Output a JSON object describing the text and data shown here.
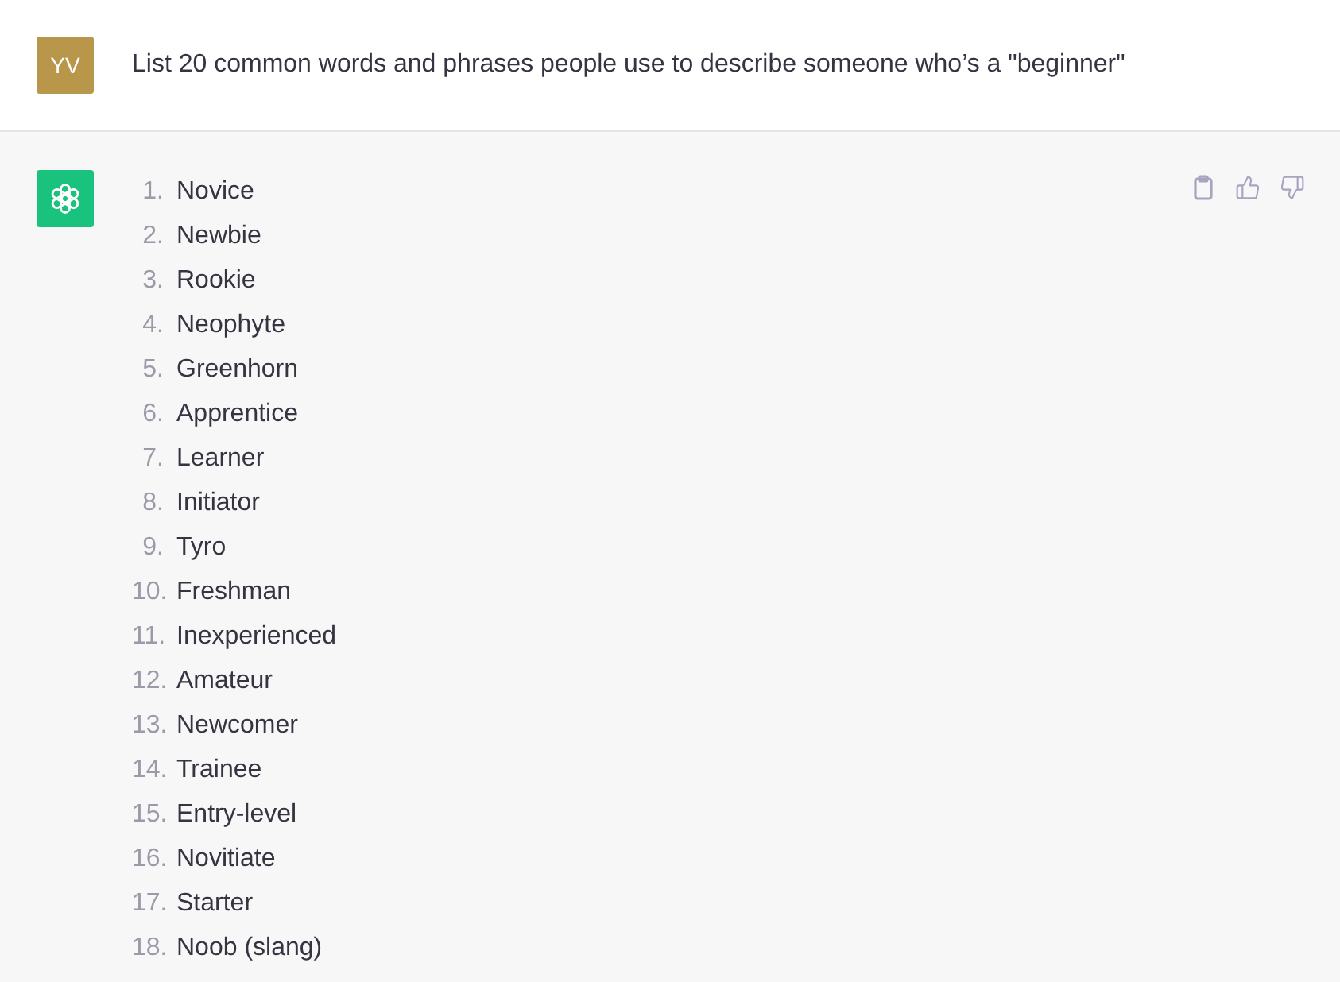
{
  "user_message": {
    "avatar": "YV",
    "text": "List 20 common words and phrases people use to describe someone who’s a \"beginner\""
  },
  "assistant_message": {
    "items": [
      {
        "number": "1.",
        "text": "Novice"
      },
      {
        "number": "2.",
        "text": "Newbie"
      },
      {
        "number": "3.",
        "text": "Rookie"
      },
      {
        "number": "4.",
        "text": "Neophyte"
      },
      {
        "number": "5.",
        "text": "Greenhorn"
      },
      {
        "number": "6.",
        "text": "Apprentice"
      },
      {
        "number": "7.",
        "text": "Learner"
      },
      {
        "number": "8.",
        "text": "Initiator"
      },
      {
        "number": "9.",
        "text": "Tyro"
      },
      {
        "number": "10.",
        "text": "Freshman"
      },
      {
        "number": "11.",
        "text": "Inexperienced"
      },
      {
        "number": "12.",
        "text": "Amateur"
      },
      {
        "number": "13.",
        "text": "Newcomer"
      },
      {
        "number": "14.",
        "text": "Trainee"
      },
      {
        "number": "15.",
        "text": "Entry-level"
      },
      {
        "number": "16.",
        "text": "Novitiate"
      },
      {
        "number": "17.",
        "text": "Starter"
      },
      {
        "number": "18.",
        "text": "Noob (slang)"
      }
    ]
  }
}
